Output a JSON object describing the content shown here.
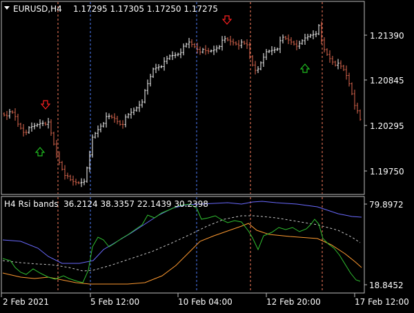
{
  "main_chart": {
    "symbol_timeframe": "EURUSD,H4",
    "ohlc": "1.17295 1.17305 1.17250 1.17275",
    "price_levels": [
      "1.21390",
      "1.20845",
      "1.20295",
      "1.19750"
    ]
  },
  "indicator": {
    "label": "H4 Rsi bands",
    "values": "36.2124 38.3357 22.1439 30.2398",
    "max": "79.8972",
    "min": "18.8452"
  },
  "time_axis": [
    "2 Feb 2021",
    "5 Feb 12:00",
    "10 Feb 04:00",
    "12 Feb 20:00",
    "17 Feb 12:00"
  ],
  "colors": {
    "background": "#000000",
    "frame": "#c0c0c0",
    "bull": "#ffffff",
    "bear": "#e0694f",
    "sell_arrow": "#ff2020",
    "buy_arrow": "#20c020",
    "vline_red": "#ff8060",
    "vline_blue": "#5080ff",
    "upper_band": "#6a6aff",
    "rsi": "#30c030",
    "lower_band": "#ff9a30",
    "mid_band": "#c8c8c8"
  },
  "icons": [
    "sell-arrow-icon",
    "buy-arrow-icon",
    "collapse-triangle-icon"
  ]
}
